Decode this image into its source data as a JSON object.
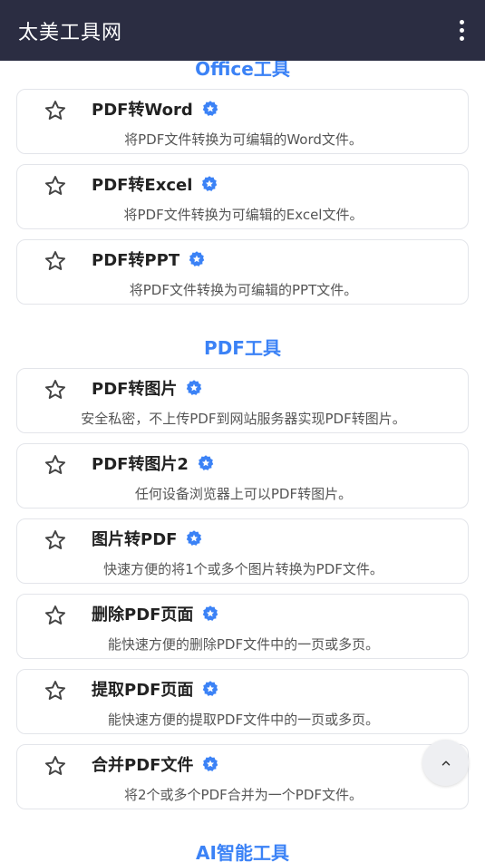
{
  "appbar": {
    "title": "太美工具网"
  },
  "sections": [
    {
      "title": "Office工具",
      "items": [
        {
          "title": "PDF转Word",
          "desc": "将PDF文件转换为可编辑的Word文件。"
        },
        {
          "title": "PDF转Excel",
          "desc": "将PDF文件转换为可编辑的Excel文件。"
        },
        {
          "title": "PDF转PPT",
          "desc": "将PDF文件转换为可编辑的PPT文件。"
        }
      ]
    },
    {
      "title": "PDF工具",
      "items": [
        {
          "title": "PDF转图片",
          "desc": "安全私密，不上传PDF到网站服务器实现PDF转图片。"
        },
        {
          "title": "PDF转图片2",
          "desc": "任何设备浏览器上可以PDF转图片。"
        },
        {
          "title": "图片转PDF",
          "desc": "快速方便的将1个或多个图片转换为PDF文件。"
        },
        {
          "title": "删除PDF页面",
          "desc": "能快速方便的删除PDF文件中的一页或多页。"
        },
        {
          "title": "提取PDF页面",
          "desc": "能快速方便的提取PDF文件中的一页或多页。"
        },
        {
          "title": "合并PDF文件",
          "desc": "将2个或多个PDF合并为一个PDF文件。"
        }
      ]
    },
    {
      "title": "AI智能工具",
      "items": []
    }
  ],
  "icons": {
    "favorite": "star-outline-icon",
    "badge": "verified-badge-icon",
    "menu": "more-vertical-icon",
    "scroll_top": "chevron-up-icon"
  },
  "colors": {
    "appbar": "#2b2d42",
    "accent": "#3b82f6"
  }
}
